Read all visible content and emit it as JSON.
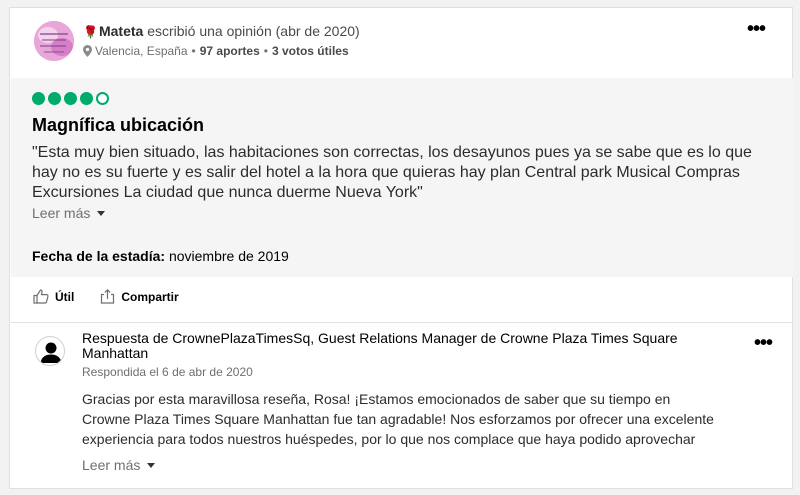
{
  "review": {
    "username": "Mateta",
    "action_text": "escribió una opinión (abr de 2020)",
    "location": "Valencia, España",
    "contributions": "97 aportes",
    "helpful_votes": "3 votos útiles",
    "more_icon": "more-dots-icon",
    "rating": {
      "value": 4,
      "max": 5
    },
    "title": "Magnífica ubicación",
    "text": "\"Esta muy bien situado, las habitaciones son correctas, los desayunos pues ya se sabe que es lo que hay no es su fuerte y es salir del hotel a la hora que quieras hay plan Central park Musical Compras Excursiones La ciudad que nunca duerme Nueva York\"",
    "read_more": "Leer más",
    "stay_label": "Fecha de la estadía:",
    "stay_date": "noviembre de 2019",
    "colors": {
      "bubble": "#00aa6c",
      "rose": "#c8102e"
    }
  },
  "actions": {
    "helpful": "Útil",
    "share": "Compartir"
  },
  "response": {
    "title": "Respuesta de CrownePlazaTimesSq, Guest Relations Manager de Crowne Plaza Times Square Manhattan",
    "date": "Respondida el 6 de abr de 2020",
    "text": "Gracias por esta maravillosa reseña, Rosa! ¡Estamos emocionados de saber que su tiempo en Crowne Plaza Times Square Manhattan fue tan agradable! Nos esforzamos por ofrecer una excelente experiencia para todos nuestros huéspedes, por lo que nos complace que haya podido aprovechar",
    "read_more": "Leer más"
  }
}
